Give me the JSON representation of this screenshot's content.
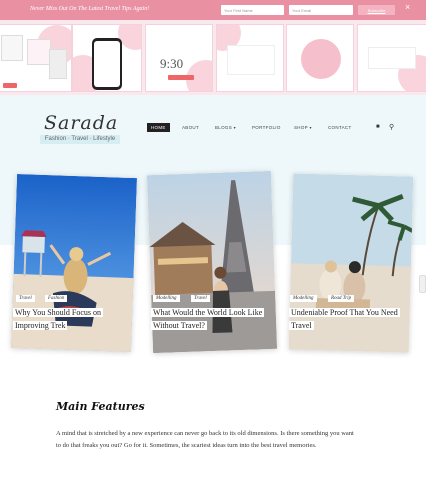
{
  "topbar": {
    "message": "Never Miss Out On The Latest Travel Tips Again!",
    "name_placeholder": "Your First Name",
    "email_placeholder": "Your Email",
    "subscribe_label": "Subscribe",
    "close_label": "×"
  },
  "banner": {
    "clock_time": "9:30"
  },
  "brand": {
    "logo": "Sarada",
    "tagline": "Fashion · Travel · Lifestyle"
  },
  "nav": {
    "items": [
      "HOME",
      "ABOUT",
      "BLOGS",
      "PORTFOLIO",
      "SHOP",
      "CONTACT"
    ]
  },
  "icons": {
    "cart": "cart-icon",
    "search": "search-icon"
  },
  "cards": [
    {
      "tags": [
        "Travel",
        "Fashion"
      ],
      "title_lines": [
        "Why You Should Focus on",
        "Improving Trek"
      ]
    },
    {
      "tags": [
        "Modelling",
        "Travel"
      ],
      "title_lines": [
        "What Would the World Look Like",
        "Without Travel?"
      ]
    },
    {
      "tags": [
        "Modelling",
        "Road Trip"
      ],
      "title_lines": [
        "Undeniable Proof That You Need",
        "Travel"
      ]
    }
  ],
  "features": {
    "title": "Main Features",
    "body": "A mind that is stretched by a new experience can never go back to its old dimensions. Is there something you want to do that freaks you out? Go for it. Sometimes, the scariest ideas turn into the best travel memories."
  },
  "colors": {
    "topbar": "#e991a3",
    "header_bg": "#eef8fb",
    "accent": "#f3b3c0"
  }
}
